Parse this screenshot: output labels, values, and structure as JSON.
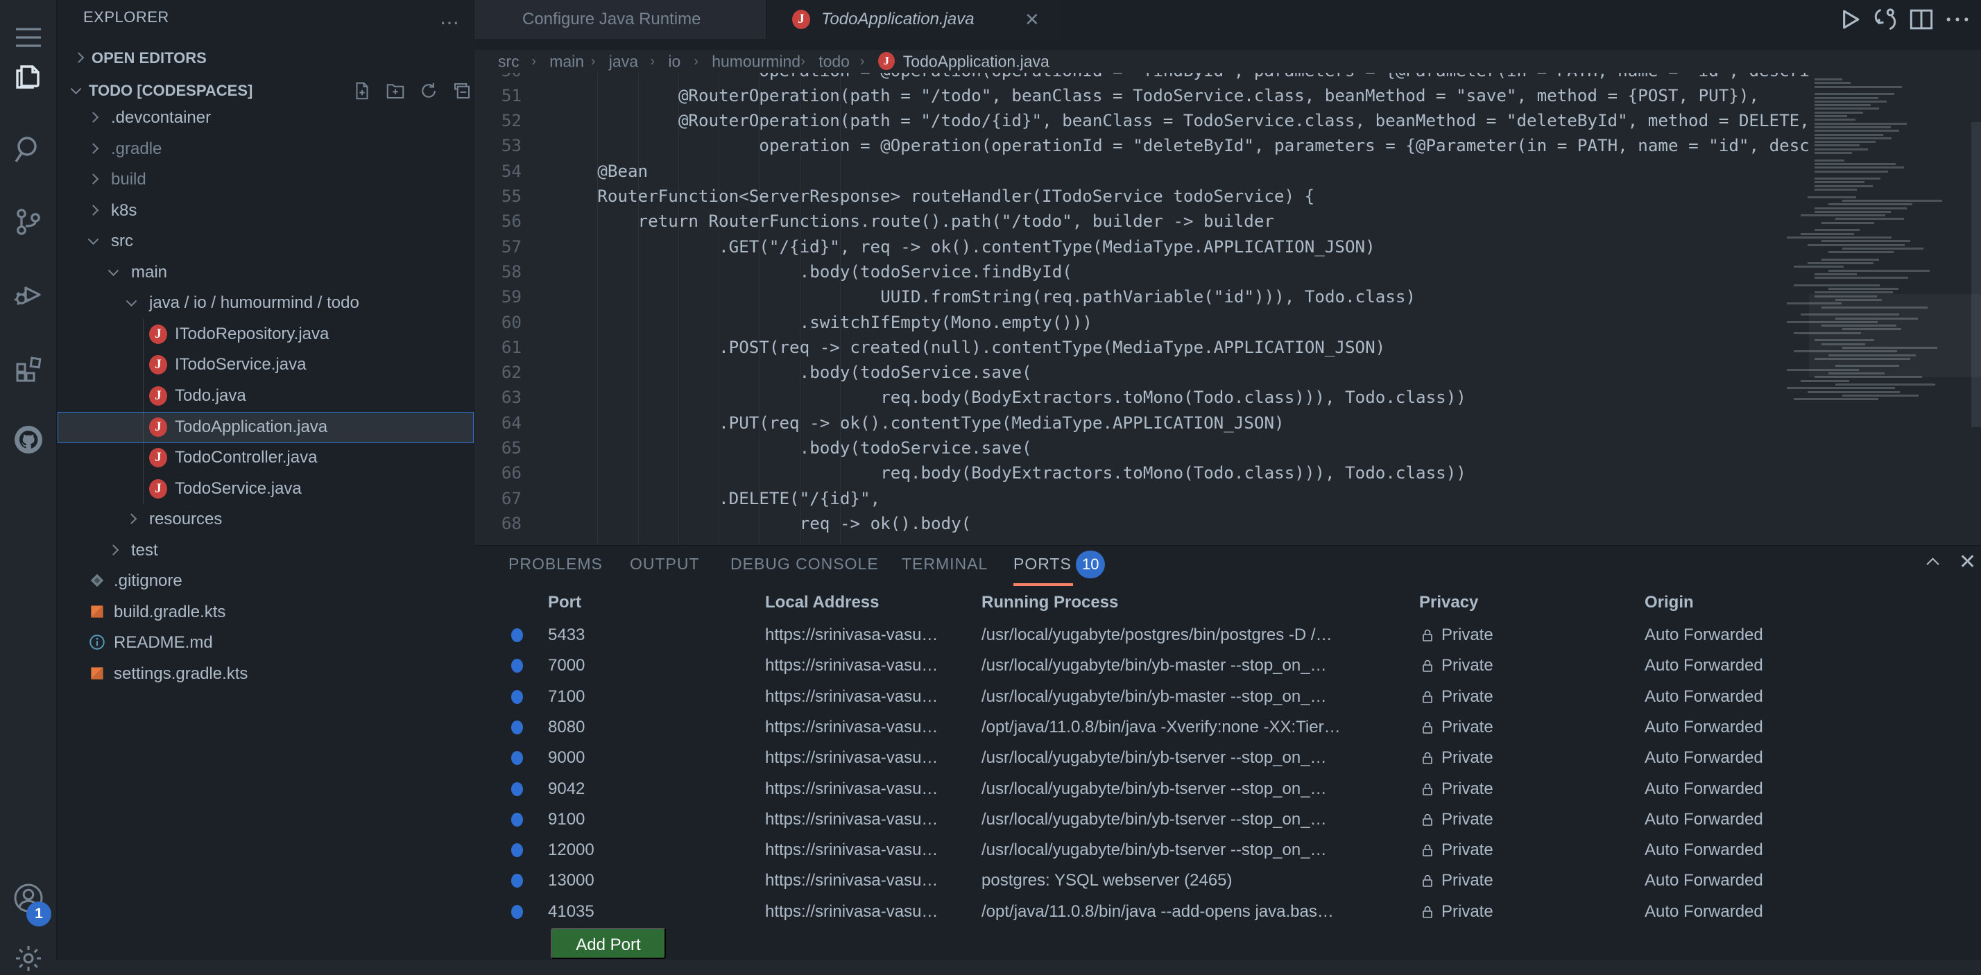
{
  "activity_bar": {
    "icons": [
      "menu",
      "explorer",
      "search",
      "source-control",
      "run-debug",
      "extensions",
      "github"
    ],
    "bottom_icons": [
      "account",
      "settings"
    ],
    "account_badge": "1"
  },
  "sidebar": {
    "title": "EXPLORER",
    "sections": {
      "open_editors": "OPEN EDITORS",
      "project": "TODO [CODESPACES]"
    },
    "project_actions": [
      "new-file",
      "new-folder",
      "refresh",
      "collapse-all"
    ],
    "tree": [
      {
        "label": ".devcontainer",
        "lvl": 1,
        "kind": "folder",
        "chevron": "right"
      },
      {
        "label": ".gradle",
        "lvl": 1,
        "kind": "folder",
        "chevron": "right",
        "dim": true
      },
      {
        "label": "build",
        "lvl": 1,
        "kind": "folder",
        "chevron": "right",
        "dim": true
      },
      {
        "label": "k8s",
        "lvl": 1,
        "kind": "folder",
        "chevron": "right"
      },
      {
        "label": "src",
        "lvl": 1,
        "kind": "folder",
        "chevron": "down"
      },
      {
        "label": "main",
        "lvl": 2,
        "kind": "folder",
        "chevron": "down"
      },
      {
        "label": "java / io / humourmind / todo",
        "lvl": 3,
        "kind": "folder",
        "chevron": "down"
      },
      {
        "label": "ITodoRepository.java",
        "lvl": 4,
        "kind": "file",
        "icon": "java"
      },
      {
        "label": "ITodoService.java",
        "lvl": 4,
        "kind": "file",
        "icon": "java"
      },
      {
        "label": "Todo.java",
        "lvl": 4,
        "kind": "file",
        "icon": "java"
      },
      {
        "label": "TodoApplication.java",
        "lvl": 4,
        "kind": "file",
        "icon": "java",
        "selected": true
      },
      {
        "label": "TodoController.java",
        "lvl": 4,
        "kind": "file",
        "icon": "java"
      },
      {
        "label": "TodoService.java",
        "lvl": 4,
        "kind": "file",
        "icon": "java"
      },
      {
        "label": "resources",
        "lvl": 3,
        "kind": "folder",
        "chevron": "right"
      },
      {
        "label": "test",
        "lvl": 2,
        "kind": "folder",
        "chevron": "right"
      },
      {
        "label": ".gitignore",
        "lvl": 1,
        "kind": "file",
        "icon": "git"
      },
      {
        "label": "build.gradle.kts",
        "lvl": 1,
        "kind": "file",
        "icon": "kotlin"
      },
      {
        "label": "README.md",
        "lvl": 1,
        "kind": "file",
        "icon": "info"
      },
      {
        "label": "settings.gradle.kts",
        "lvl": 1,
        "kind": "file",
        "icon": "kotlin"
      }
    ]
  },
  "tabs": [
    {
      "label": "Configure Java Runtime",
      "active": false
    },
    {
      "label": "TodoApplication.java",
      "active": true,
      "icon": "java",
      "close": true
    }
  ],
  "editor_actions": [
    "run",
    "sync",
    "split-editor",
    "more"
  ],
  "breadcrumbs": [
    "src",
    "main",
    "java",
    "io",
    "humourmind",
    "todo",
    "TodoApplication.java"
  ],
  "code": {
    "lines": [
      {
        "n": 50,
        "indent": 20,
        "text": "operation = @Operation(operationId = \"findById\", parameters = {@Parameter(in = PATH, name = \"id\", description = \"\")}),"
      },
      {
        "n": 51,
        "indent": 12,
        "text": "@RouterOperation(path = \"/todo\", beanClass = TodoService.class, beanMethod = \"save\", method = {POST, PUT}),"
      },
      {
        "n": 52,
        "indent": 12,
        "text": "@RouterOperation(path = \"/todo/{id}\", beanClass = TodoService.class, beanMethod = \"deleteById\", method = DELETE,"
      },
      {
        "n": 53,
        "indent": 20,
        "text": "operation = @Operation(operationId = \"deleteById\", parameters = {@Parameter(in = PATH, name = \"id\", description = \"\")}),"
      },
      {
        "n": 54,
        "indent": 4,
        "text": "@Bean"
      },
      {
        "n": 55,
        "indent": 4,
        "text": "RouterFunction<ServerResponse> routeHandler(ITodoService todoService) {"
      },
      {
        "n": 56,
        "indent": 8,
        "text": "return RouterFunctions.route().path(\"/todo\", builder -> builder"
      },
      {
        "n": 57,
        "indent": 16,
        "text": ".GET(\"/{id}\", req -> ok().contentType(MediaType.APPLICATION_JSON)"
      },
      {
        "n": 58,
        "indent": 24,
        "text": ".body(todoService.findById("
      },
      {
        "n": 59,
        "indent": 32,
        "text": "UUID.fromString(req.pathVariable(\"id\"))), Todo.class)"
      },
      {
        "n": 60,
        "indent": 24,
        "text": ".switchIfEmpty(Mono.empty()))"
      },
      {
        "n": 61,
        "indent": 16,
        "text": ".POST(req -> created(null).contentType(MediaType.APPLICATION_JSON)"
      },
      {
        "n": 62,
        "indent": 24,
        "text": ".body(todoService.save("
      },
      {
        "n": 63,
        "indent": 32,
        "text": "req.body(BodyExtractors.toMono(Todo.class))), Todo.class))"
      },
      {
        "n": 64,
        "indent": 16,
        "text": ".PUT(req -> ok().contentType(MediaType.APPLICATION_JSON)"
      },
      {
        "n": 65,
        "indent": 24,
        "text": ".body(todoService.save("
      },
      {
        "n": 66,
        "indent": 32,
        "text": "req.body(BodyExtractors.toMono(Todo.class))), Todo.class))"
      },
      {
        "n": 67,
        "indent": 16,
        "text": ".DELETE(\"/{id}\","
      },
      {
        "n": 68,
        "indent": 24,
        "text": "req -> ok().body("
      }
    ]
  },
  "panel": {
    "tabs": [
      {
        "label": "PROBLEMS"
      },
      {
        "label": "OUTPUT"
      },
      {
        "label": "DEBUG CONSOLE"
      },
      {
        "label": "TERMINAL"
      },
      {
        "label": "PORTS",
        "active": true,
        "badge": "10"
      }
    ],
    "columns": [
      "Port",
      "Local Address",
      "Running Process",
      "Privacy",
      "Origin"
    ],
    "rows": [
      {
        "port": "5433",
        "address": "https://srinivasa-vasu…",
        "process": "/usr/local/yugabyte/postgres/bin/postgres -D /…",
        "privacy": "Private",
        "origin": "Auto Forwarded"
      },
      {
        "port": "7000",
        "address": "https://srinivasa-vasu…",
        "process": "/usr/local/yugabyte/bin/yb-master --stop_on_…",
        "privacy": "Private",
        "origin": "Auto Forwarded"
      },
      {
        "port": "7100",
        "address": "https://srinivasa-vasu…",
        "process": "/usr/local/yugabyte/bin/yb-master --stop_on_…",
        "privacy": "Private",
        "origin": "Auto Forwarded"
      },
      {
        "port": "8080",
        "address": "https://srinivasa-vasu…",
        "process": "/opt/java/11.0.8/bin/java -Xverify:none -XX:Tier…",
        "privacy": "Private",
        "origin": "Auto Forwarded"
      },
      {
        "port": "9000",
        "address": "https://srinivasa-vasu…",
        "process": "/usr/local/yugabyte/bin/yb-tserver --stop_on_…",
        "privacy": "Private",
        "origin": "Auto Forwarded"
      },
      {
        "port": "9042",
        "address": "https://srinivasa-vasu…",
        "process": "/usr/local/yugabyte/bin/yb-tserver --stop_on_…",
        "privacy": "Private",
        "origin": "Auto Forwarded"
      },
      {
        "port": "9100",
        "address": "https://srinivasa-vasu…",
        "process": "/usr/local/yugabyte/bin/yb-tserver --stop_on_…",
        "privacy": "Private",
        "origin": "Auto Forwarded"
      },
      {
        "port": "12000",
        "address": "https://srinivasa-vasu…",
        "process": "/usr/local/yugabyte/bin/yb-tserver --stop_on_…",
        "privacy": "Private",
        "origin": "Auto Forwarded"
      },
      {
        "port": "13000",
        "address": "https://srinivasa-vasu…",
        "process": "postgres: YSQL webserver (2465)",
        "privacy": "Private",
        "origin": "Auto Forwarded"
      },
      {
        "port": "41035",
        "address": "https://srinivasa-vasu…",
        "process": "/opt/java/11.0.8/bin/java --add-opens java.bas…",
        "privacy": "Private",
        "origin": "Auto Forwarded"
      }
    ],
    "add_button": "Add Port"
  },
  "colors": {
    "accent_blue": "#316dca",
    "port_dot": "#2f6fd3",
    "ports_underline": "#f78166",
    "java_icon": "#c8433f",
    "kotlin_icon": "#e8793e",
    "add_button_bg": "#2e6b34",
    "selected_row_bg": "#2d333b"
  }
}
